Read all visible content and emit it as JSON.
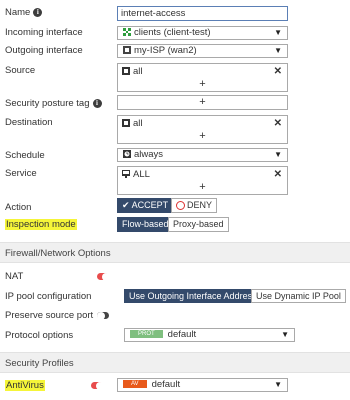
{
  "colors": {
    "accent": "#344a6b",
    "toggle_on": "#e84c4c",
    "toggle_off": "#444444",
    "highlight": "#f5f539",
    "prot_tag": "#7fbf7f",
    "av_tag": "#e85a1b"
  },
  "policy": {
    "name": {
      "label": "Name",
      "value": "internet-access",
      "icon": "info-icon"
    },
    "incoming": {
      "label": "Incoming interface",
      "value": "clients (client-test)",
      "icon": "network-icon"
    },
    "outgoing": {
      "label": "Outgoing interface",
      "value": "my-ISP (wan2)",
      "icon": "port-icon"
    },
    "source": {
      "label": "Source",
      "value": "all",
      "icon": "address-icon"
    },
    "posture": {
      "label": "Security posture tag",
      "icon": "info-icon"
    },
    "destination": {
      "label": "Destination",
      "value": "all",
      "icon": "address-icon"
    },
    "schedule": {
      "label": "Schedule",
      "value": "always",
      "icon": "clock-icon"
    },
    "service": {
      "label": "Service",
      "value": "ALL",
      "icon": "monitor-icon"
    },
    "action": {
      "label": "Action",
      "accept": "ACCEPT",
      "deny": "DENY"
    },
    "inspection": {
      "label": "Inspection mode",
      "flow": "Flow-based",
      "proxy": "Proxy-based"
    }
  },
  "firewall": {
    "header": "Firewall/Network Options",
    "nat": {
      "label": "NAT",
      "enabled": true
    },
    "ippool": {
      "label": "IP pool configuration",
      "opt1": "Use Outgoing Interface Address",
      "opt2": "Use Dynamic IP Pool"
    },
    "preserve": {
      "label": "Preserve source port",
      "enabled": false
    },
    "protocol": {
      "label": "Protocol options",
      "tag": "PROT",
      "value": "default"
    }
  },
  "profiles": {
    "header": "Security Profiles",
    "antivirus": {
      "label": "AntiVirus",
      "enabled": true,
      "tag": "AV",
      "value": "default"
    }
  }
}
